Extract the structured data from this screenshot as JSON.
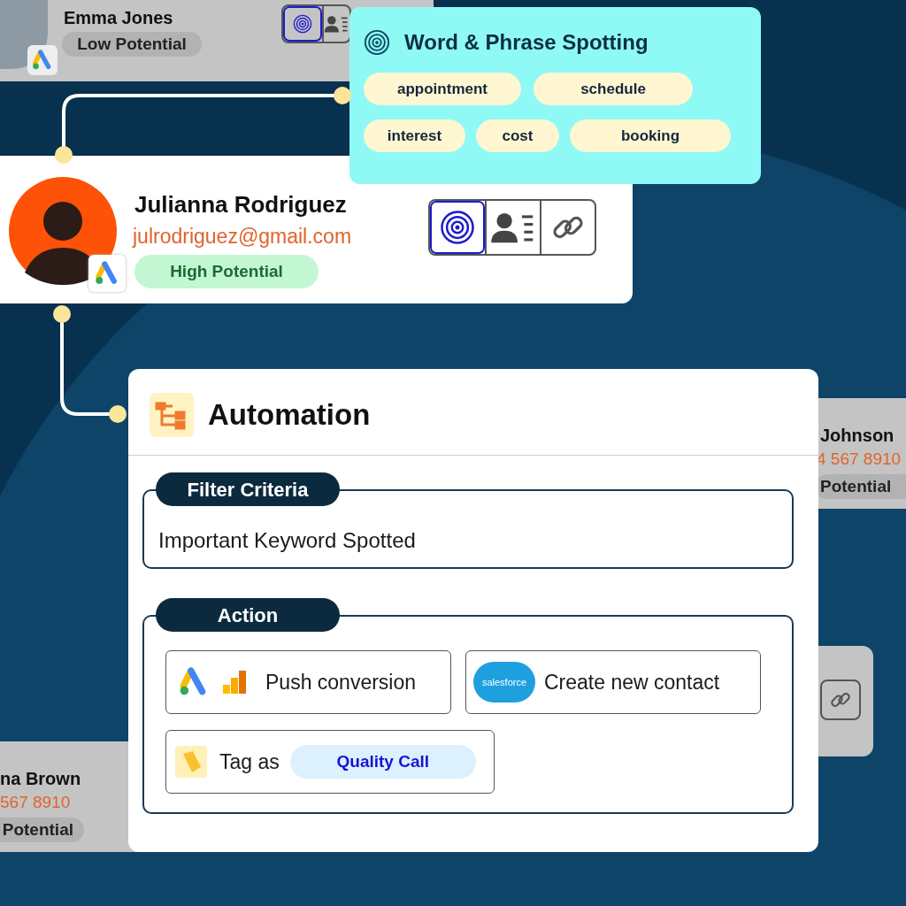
{
  "top_contact": {
    "name": "Emma Jones",
    "badge": "Low Potential",
    "dimmed": true,
    "tools": [
      {
        "kind": "spotting",
        "selected": true
      },
      {
        "kind": "profile",
        "selected": false
      }
    ]
  },
  "spotting": {
    "title": "Word & Phrase Spotting",
    "rows": [
      [
        "appointment",
        "schedule"
      ],
      [
        "interest",
        "cost",
        "booking"
      ]
    ]
  },
  "main_contact": {
    "name": "Julianna Rodriguez",
    "email": "julrodriguez@gmail.com",
    "badge": "High Potential",
    "dimmed": false,
    "tools": [
      {
        "kind": "spotting",
        "selected": true
      },
      {
        "kind": "profile",
        "selected": false
      },
      {
        "kind": "link",
        "selected": false
      }
    ]
  },
  "right_contact": {
    "name": "Johnson",
    "phone": "4 567 8910",
    "badge": "Potential"
  },
  "left_contact": {
    "name": "na Brown",
    "phone": "567 8910",
    "badge": "Potential"
  },
  "lower_right_card": {
    "tools": [
      {
        "kind": "link",
        "selected": false
      }
    ]
  },
  "automation": {
    "title": "Automation",
    "filter": {
      "label": "Filter Criteria",
      "value": "Important Keyword Spotted"
    },
    "action": {
      "label": "Action",
      "items": [
        {
          "kind": "conversion",
          "text": "Push conversion"
        },
        {
          "kind": "contact",
          "text": "Create new contact",
          "logo_text": "salesforce"
        },
        {
          "kind": "tag",
          "text": "Tag as",
          "tag": "Quality Call"
        }
      ]
    }
  }
}
